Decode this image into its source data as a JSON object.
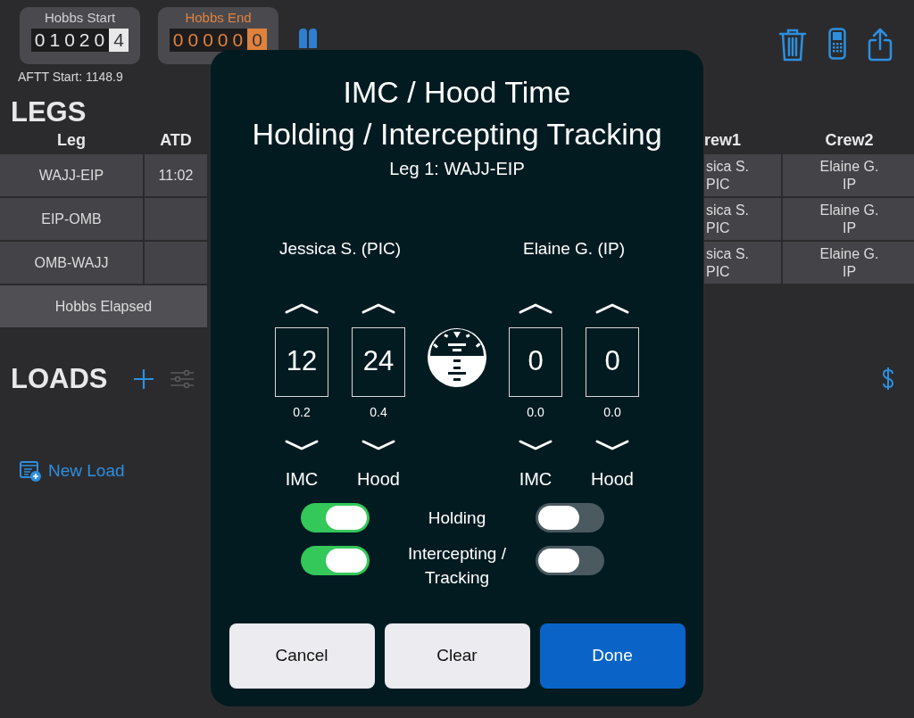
{
  "header": {
    "counters": [
      {
        "label": "Hobbs Start",
        "digits": "01020",
        "last_digit": "4",
        "kind": "start"
      },
      {
        "label": "Hobbs End",
        "digits": "00000",
        "last_digit": "0",
        "kind": "end"
      }
    ],
    "aftt_start": "AFTT Start: 1148.9"
  },
  "legs": {
    "title": "LEGS",
    "columns": [
      "Leg",
      "ATD",
      "rew1",
      "Crew2"
    ],
    "rows": [
      {
        "leg": "WAJJ-EIP",
        "atd": "11:02",
        "crew1": [
          "sica S.",
          "PIC"
        ],
        "crew2": [
          "Elaine G.",
          "IP"
        ]
      },
      {
        "leg": "EIP-OMB",
        "atd": "",
        "crew1": [
          "sica S.",
          "PIC"
        ],
        "crew2": [
          "Elaine G.",
          "IP"
        ]
      },
      {
        "leg": "OMB-WAJJ",
        "atd": "",
        "crew1": [
          "sica S.",
          "PIC"
        ],
        "crew2": [
          "Elaine G.",
          "IP"
        ]
      }
    ],
    "footer": "Hobbs Elapsed"
  },
  "loads": {
    "title": "LOADS",
    "new_load": "New Load"
  },
  "dialog": {
    "title_lines": [
      "IMC / Hood Time",
      "Holding / Intercepting Tracking"
    ],
    "subtitle": "Leg 1: WAJJ-EIP",
    "crew": [
      {
        "name": "Jessica S. (PIC)",
        "counters": [
          {
            "value": "12",
            "hours": "0.2",
            "label": "IMC"
          },
          {
            "value": "24",
            "hours": "0.4",
            "label": "Hood"
          }
        ],
        "toggles": [
          {
            "on": true
          },
          {
            "on": true
          }
        ]
      },
      {
        "name": "Elaine G. (IP)",
        "counters": [
          {
            "value": "0",
            "hours": "0.0",
            "label": "IMC"
          },
          {
            "value": "0",
            "hours": "0.0",
            "label": "Hood"
          }
        ],
        "toggles": [
          {
            "on": false
          },
          {
            "on": false
          }
        ]
      }
    ],
    "toggle_labels": [
      "Holding",
      "Intercepting / Tracking"
    ],
    "buttons": [
      {
        "label": "Cancel",
        "kind": "secondary"
      },
      {
        "label": "Clear",
        "kind": "secondary"
      },
      {
        "label": "Done",
        "kind": "primary"
      }
    ]
  }
}
